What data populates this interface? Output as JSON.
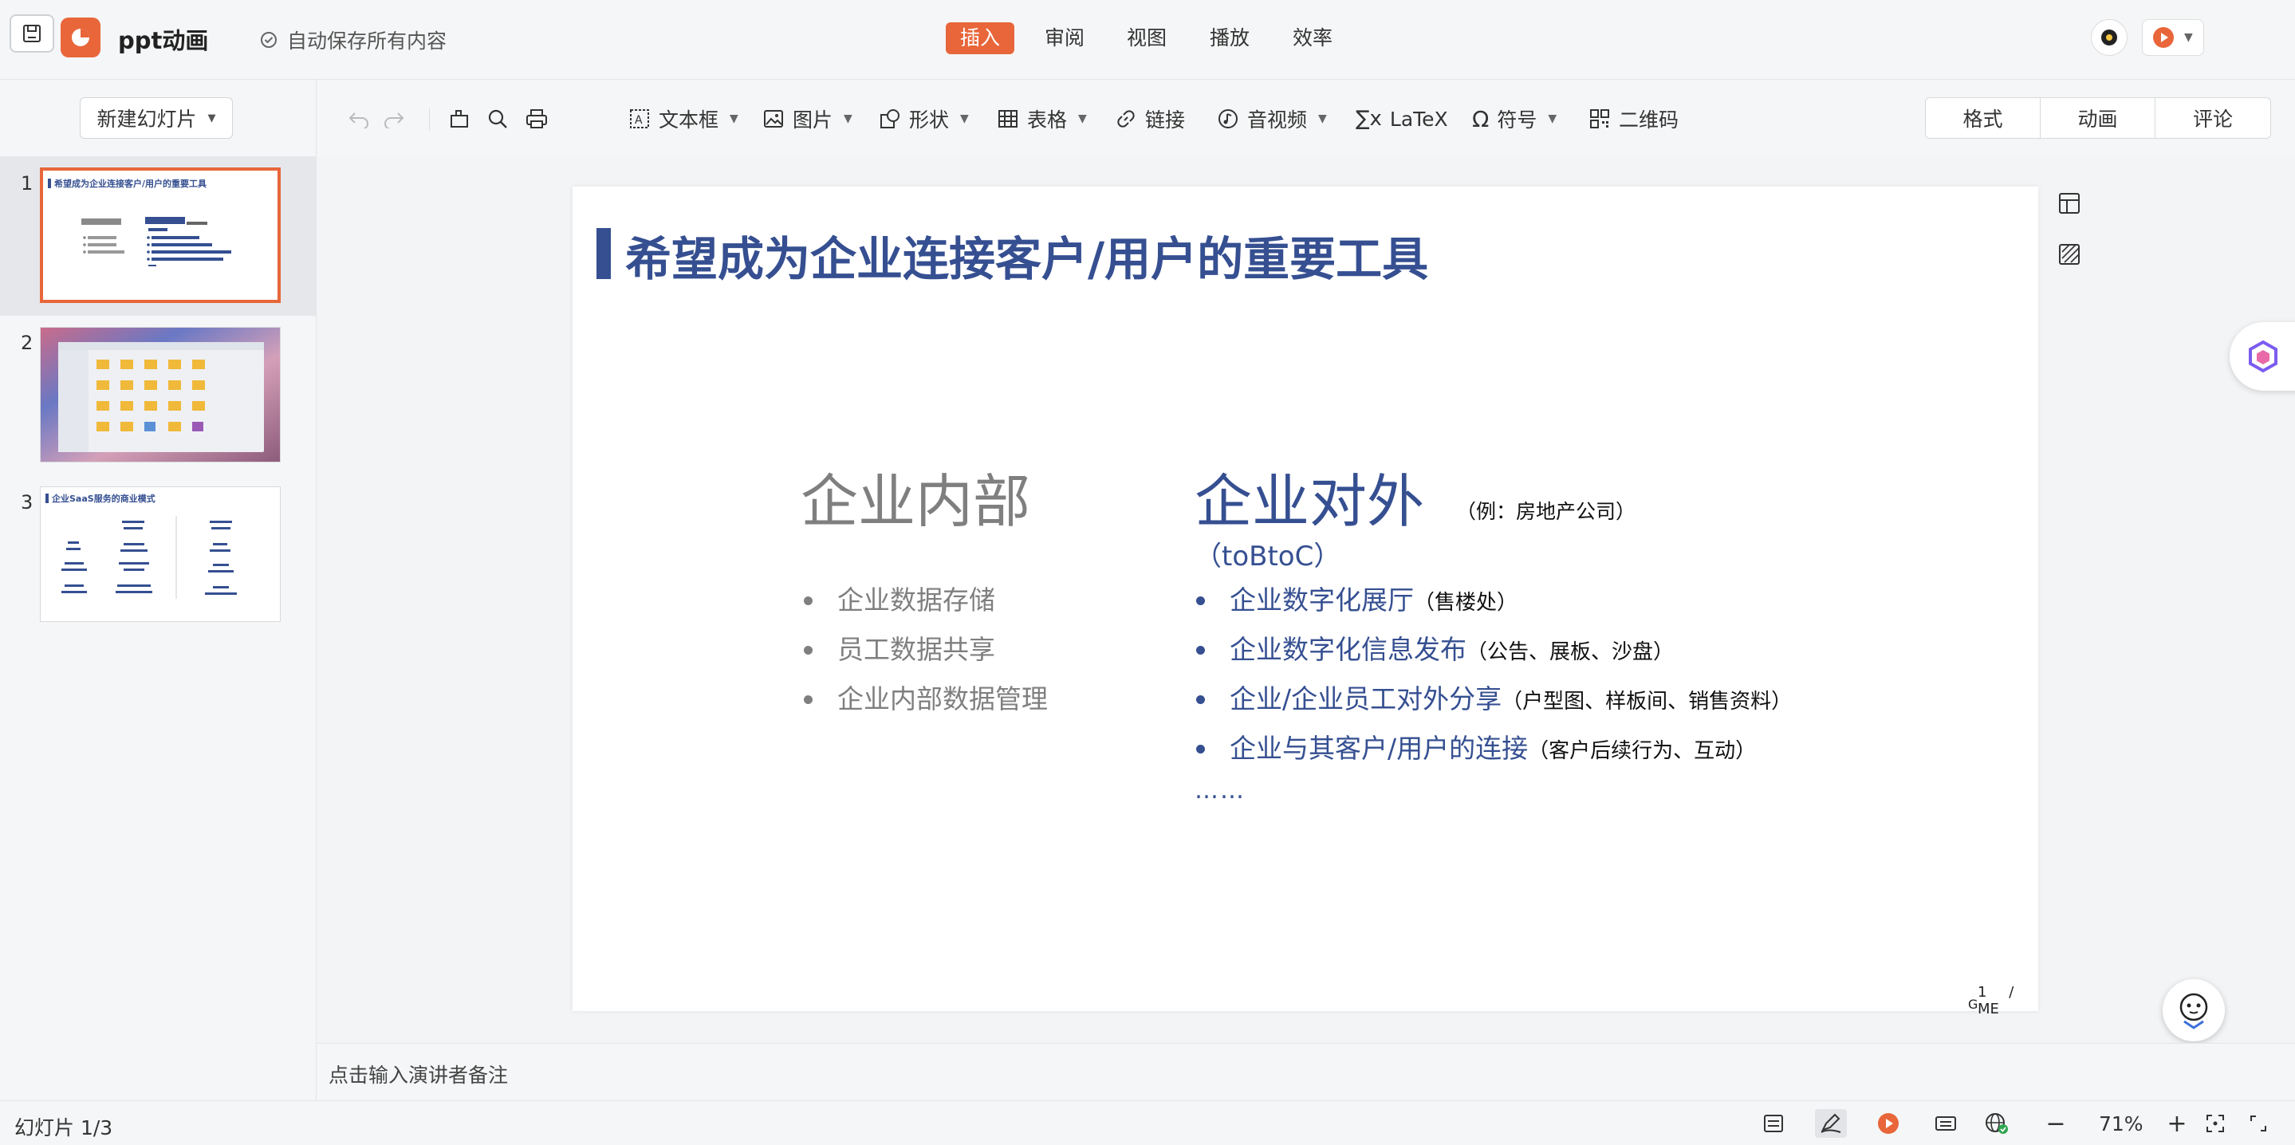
{
  "app": {
    "doc_title": "ppt动画",
    "autosave": "自动保存所有内容",
    "accent": "#e8663a",
    "menu": [
      "插入",
      "审阅",
      "视图",
      "播放",
      "效率"
    ],
    "active_menu": "插入"
  },
  "left_panel": {
    "new_slide_label": "新建幻灯片",
    "thumbnails": [
      {
        "num": "1",
        "title": "希望成为企业连接客户/用户的重要工具",
        "selected": true
      },
      {
        "num": "2",
        "selected": false
      },
      {
        "num": "3",
        "title": "企业SaaS服务的商业模式",
        "selected": false
      }
    ]
  },
  "toolbar": {
    "textbox": "文本框",
    "image": "图片",
    "shape": "形状",
    "table": "表格",
    "link": "链接",
    "media": "音视频",
    "latex": "LaTeX",
    "symbol": "符号",
    "qrcode": "二维码",
    "right_tabs": [
      "格式",
      "动画",
      "评论"
    ]
  },
  "slide": {
    "title": "希望成为企业连接客户/用户的重要工具",
    "left_heading": "企业内部",
    "left_bullets": [
      "企业数据存储",
      "员工数据共享",
      "企业内部数据管理"
    ],
    "right_heading": "企业对外",
    "right_example": "（例：房地产公司）",
    "right_sub": "（toBtoC）",
    "right_bullets": [
      {
        "text": "企业数字化展厅",
        "note": "（售楼处）"
      },
      {
        "text": "企业数字化信息发布",
        "note": "（公告、展板、沙盘）"
      },
      {
        "text": "企业/企业员工对外分享",
        "note": "（户型图、样板间、销售资料）"
      },
      {
        "text": "企业与其客户/用户的连接",
        "note": "（客户后续行为、互动）"
      }
    ],
    "ellipsis": "……",
    "page_num": "1",
    "page_suffix": "/ ME",
    "page_g": "G",
    "title_color": "#354f91",
    "grey_color": "#7f7f7f"
  },
  "notes": {
    "placeholder": "点击输入演讲者备注"
  },
  "status": {
    "slide_count": "幻灯片 1/3",
    "zoom": "71%"
  }
}
